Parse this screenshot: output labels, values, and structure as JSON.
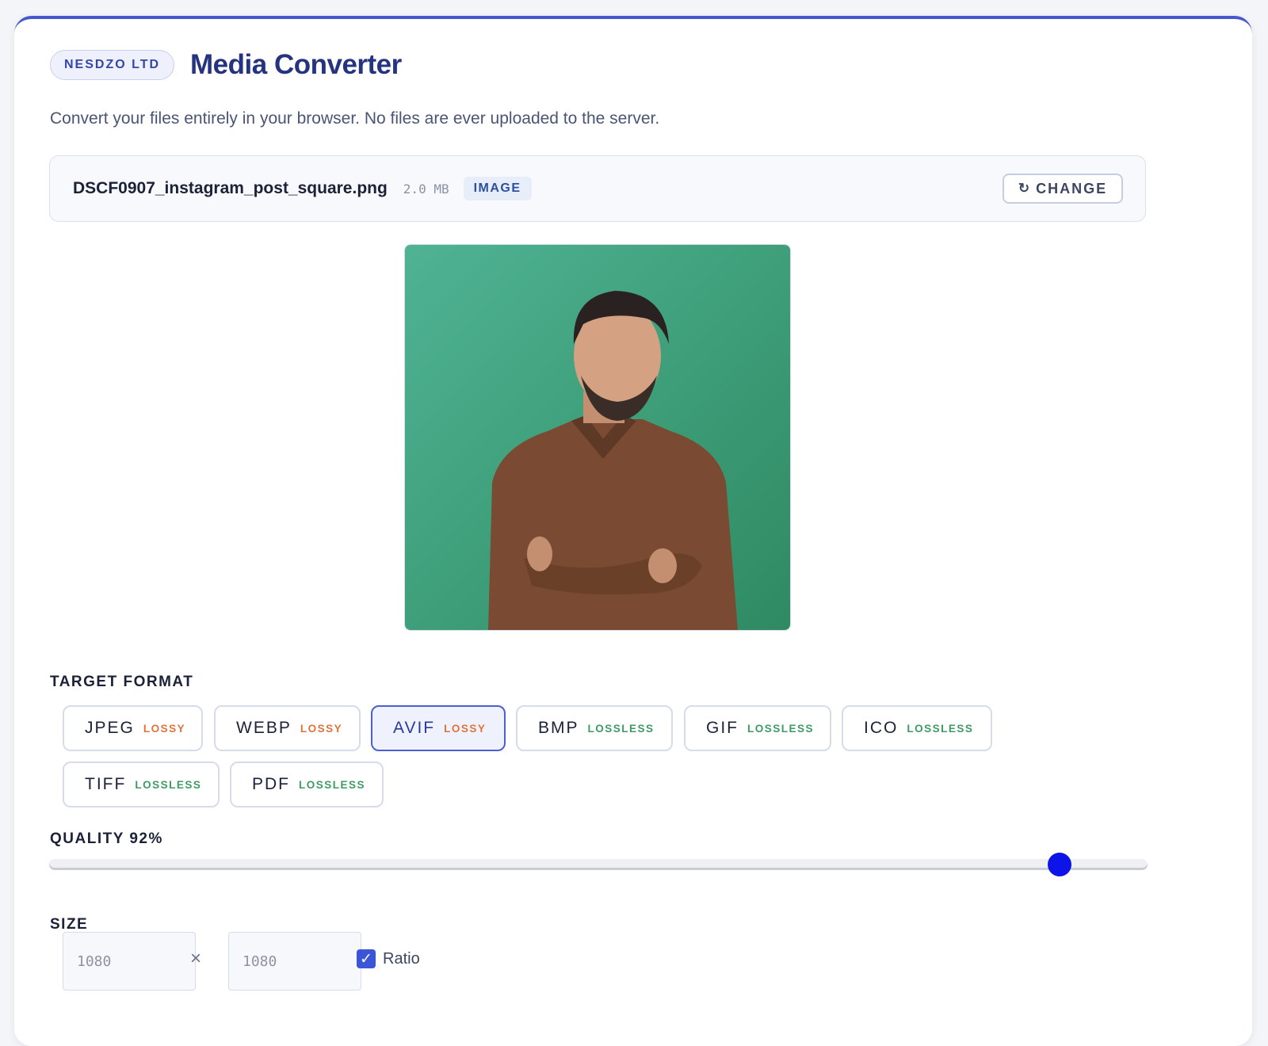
{
  "header": {
    "company_badge": "NESDZO LTD",
    "title": "Media Converter",
    "subtitle": "Convert your files entirely in your browser. No files are ever uploaded to the server."
  },
  "file": {
    "name": "DSCF0907_instagram_post_square.png",
    "size": "2.0 MB",
    "type": "IMAGE",
    "change_label": "CHANGE",
    "change_icon": "refresh-icon"
  },
  "preview": {
    "background_color": "#3e9f7a"
  },
  "target_format": {
    "label": "TARGET FORMAT",
    "selected": "AVIF",
    "options": [
      {
        "name": "JPEG",
        "tag": "LOSSY"
      },
      {
        "name": "WEBP",
        "tag": "LOSSY"
      },
      {
        "name": "AVIF",
        "tag": "LOSSY"
      },
      {
        "name": "BMP",
        "tag": "LOSSLESS"
      },
      {
        "name": "GIF",
        "tag": "LOSSLESS"
      },
      {
        "name": "ICO",
        "tag": "LOSSLESS"
      },
      {
        "name": "TIFF",
        "tag": "LOSSLESS"
      },
      {
        "name": "PDF",
        "tag": "LOSSLESS"
      }
    ]
  },
  "quality": {
    "label": "QUALITY 92%",
    "value_percent": 92
  },
  "size": {
    "label": "SIZE",
    "width_placeholder": "1080",
    "height_placeholder": "1080",
    "separator": "×",
    "ratio_label": "Ratio",
    "ratio_checked": true
  },
  "colors": {
    "accent": "#4658cf",
    "title": "#253481",
    "lossy": "#e0743c",
    "lossless": "#3f9a63",
    "slider_thumb": "#0d14e8"
  }
}
